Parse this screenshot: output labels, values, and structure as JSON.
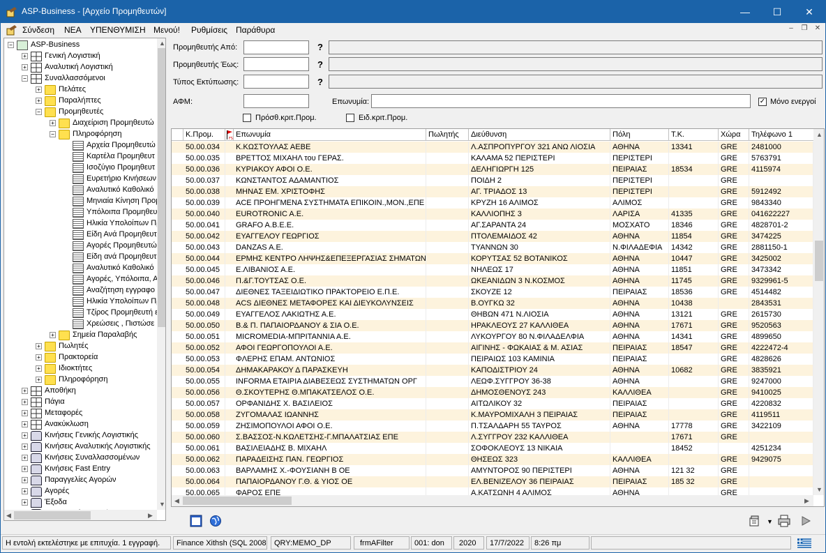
{
  "window": {
    "title": "ASP-Business - [Αρχείο Προμηθευτών]",
    "minimize": "—",
    "maximize": "☐",
    "close": "✕"
  },
  "menu": [
    "Σύνδεση",
    "ΝΕΑ",
    "ΥΠΕΝΘΥΜΙΣΗ",
    "Μενού!",
    "Ρυθμίσεις",
    "Παράθυρα"
  ],
  "mdi": {
    "minimize": "–",
    "restore": "❐",
    "close": "✕"
  },
  "tree": [
    {
      "label": "ASP-Business",
      "level": 0,
      "exp": "−",
      "icon": "root"
    },
    {
      "label": "Γενική Λογιστική",
      "level": 1,
      "exp": "+",
      "icon": "grid"
    },
    {
      "label": "Αναλυτική Λογιστική",
      "level": 1,
      "exp": "+",
      "icon": "grid"
    },
    {
      "label": "Συναλλασσόμενοι",
      "level": 1,
      "exp": "−",
      "icon": "grid"
    },
    {
      "label": "Πελάτες",
      "level": 2,
      "exp": "+",
      "icon": "folder"
    },
    {
      "label": "Παραλήπτες",
      "level": 2,
      "exp": "+",
      "icon": "folder"
    },
    {
      "label": "Προμηθευτές",
      "level": 2,
      "exp": "−",
      "icon": "folder"
    },
    {
      "label": "Διαχείριση Προμηθευτώ",
      "level": 3,
      "exp": "+",
      "icon": "folder"
    },
    {
      "label": "Πληροφόρηση",
      "level": 3,
      "exp": "−",
      "icon": "folder"
    },
    {
      "label": "Αρχεία Προμηθευτώ",
      "level": 4,
      "exp": "",
      "icon": "doc"
    },
    {
      "label": "Καρτέλα Προμηθευτ",
      "level": 4,
      "exp": "",
      "icon": "doc"
    },
    {
      "label": "Ισοζύγιο Προμηθευτ",
      "level": 4,
      "exp": "",
      "icon": "doc"
    },
    {
      "label": "Ευρετήριο Κινήσεων",
      "level": 4,
      "exp": "",
      "icon": "doc"
    },
    {
      "label": "Αναλυτικό Καθολικό",
      "level": 4,
      "exp": "",
      "icon": "doc"
    },
    {
      "label": "Μηνιαία Κίνηση Προμ",
      "level": 4,
      "exp": "",
      "icon": "doc"
    },
    {
      "label": "Υπόλοιπα Προμηθευτ",
      "level": 4,
      "exp": "",
      "icon": "doc"
    },
    {
      "label": "Ηλικία Υπολοίπων Πρ",
      "level": 4,
      "exp": "",
      "icon": "doc"
    },
    {
      "label": "Είδη Ανά Προμηθευτ",
      "level": 4,
      "exp": "",
      "icon": "doc"
    },
    {
      "label": "Αγορές Προμηθευτώ",
      "level": 4,
      "exp": "",
      "icon": "doc"
    },
    {
      "label": "Είδη ανά Προμηθευτ",
      "level": 4,
      "exp": "",
      "icon": "doc"
    },
    {
      "label": "Αναλυτικό Καθολικό",
      "level": 4,
      "exp": "",
      "icon": "doc"
    },
    {
      "label": "Αγορές, Υπόλοιπα, Α",
      "level": 4,
      "exp": "",
      "icon": "doc"
    },
    {
      "label": "Αναζήτηση εγγραφο",
      "level": 4,
      "exp": "",
      "icon": "doc"
    },
    {
      "label": "Ηλικία Υπολοίπων Πρ",
      "level": 4,
      "exp": "",
      "icon": "doc"
    },
    {
      "label": "Τζίρος Προμηθευτή ε",
      "level": 4,
      "exp": "",
      "icon": "doc"
    },
    {
      "label": "Χρεώσεις , Πιστώσε",
      "level": 4,
      "exp": "",
      "icon": "doc"
    },
    {
      "label": "Σημεία Παραλαβής",
      "level": 3,
      "exp": "+",
      "icon": "folder"
    },
    {
      "label": "Πωλητές",
      "level": 2,
      "exp": "+",
      "icon": "folder"
    },
    {
      "label": "Πρακτορεία",
      "level": 2,
      "exp": "+",
      "icon": "folder"
    },
    {
      "label": "Ιδιοκτήτες",
      "level": 2,
      "exp": "+",
      "icon": "folder"
    },
    {
      "label": "Πληροφόρηση",
      "level": 2,
      "exp": "+",
      "icon": "folder"
    },
    {
      "label": "Αποθήκη",
      "level": 1,
      "exp": "+",
      "icon": "grid"
    },
    {
      "label": "Πάγια",
      "level": 1,
      "exp": "+",
      "icon": "grid"
    },
    {
      "label": "Μεταφορές",
      "level": 1,
      "exp": "+",
      "icon": "grid"
    },
    {
      "label": "Ανακύκλωση",
      "level": 1,
      "exp": "+",
      "icon": "grid"
    },
    {
      "label": "Κινήσεις Γενικής Λογιστικής",
      "level": 1,
      "exp": "+",
      "icon": "print"
    },
    {
      "label": "Κινήσεις Αναλυτικής Λογιστικής",
      "level": 1,
      "exp": "+",
      "icon": "print"
    },
    {
      "label": "Κινήσεις Συναλλασσομένων",
      "level": 1,
      "exp": "+",
      "icon": "print"
    },
    {
      "label": "Κινήσεις Fast Entry",
      "level": 1,
      "exp": "+",
      "icon": "print"
    },
    {
      "label": "Παραγγελίες Αγορών",
      "level": 1,
      "exp": "+",
      "icon": "print"
    },
    {
      "label": "Αγορές",
      "level": 1,
      "exp": "+",
      "icon": "print"
    },
    {
      "label": "Έξοδα",
      "level": 1,
      "exp": "+",
      "icon": "print"
    },
    {
      "label": "Παραγγελίες Πωλήσεων",
      "level": 1,
      "exp": "+",
      "icon": "print"
    }
  ],
  "filters": {
    "from_label": "Προμηθευτής Από:",
    "to_label": "Προμηθευτής Έως:",
    "print_type_label": "Τύπος Εκτύπωσης:",
    "afm_label": "ΑΦΜ:",
    "name_label": "Επωνυμία:",
    "active_only_label": "Μόνο ενεργοί",
    "active_only_checked": "✓",
    "extra_crit_label": "Πρόσθ.κριτ.Προμ.",
    "special_crit_label": "Ειδ.κριτ.Προμ.",
    "from_value": "",
    "to_value": "",
    "print_type_value": "",
    "afm_value": "",
    "name_value": ""
  },
  "grid": {
    "columns": [
      "Κ.Προμ.",
      "Επωνυμία",
      "Πωλητής",
      "Διεύθυνση",
      "Πόλη",
      "Τ.Κ.",
      "Χώρα",
      "Τηλέφωνο 1"
    ],
    "flag_label": "FS",
    "rows": [
      [
        "50.00.034",
        "Κ.ΚΩΣΤΟΥΛΑΣ ΑΕΒΕ",
        "",
        "Λ.ΑΣΠΡΟΠΥΡΓΟΥ 321 ΑΝΩ ΛΙΟΣΙΑ",
        "ΑΘΗΝΑ",
        "13341",
        "GRE",
        "2481000"
      ],
      [
        "50.00.035",
        "ΒΡΕΤΤΟΣ ΜΙΧΑΗΛ του ΓΕΡΑΣ.",
        "",
        "ΚΑΛΑΜΑ 52 ΠΕΡΙΣΤΕΡΙ",
        "ΠΕΡΙΣΤΕΡΙ",
        "",
        "GRE",
        "5763791"
      ],
      [
        "50.00.036",
        "ΚΥΡΙΑΚΟΥ ΑΦΟΙ Ο.Ε.",
        "",
        "ΔΕΛΗΓΙΩΡΓΗ 125",
        "ΠΕΙΡΑΙΑΣ",
        "18534",
        "GRE",
        "4115974"
      ],
      [
        "50.00.037",
        "ΚΩΝΣΤΑΝΤΟΣ ΑΔΑΜΑΝΤΙΟΣ",
        "",
        "ΠΟΙΔΗ 2",
        "ΠΕΡΙΣΤΕΡΙ",
        "",
        "GRE",
        ""
      ],
      [
        "50.00.038",
        "ΜΗΝΑΣ ΕΜ. ΧΡΙΣΤΟΦΗΣ",
        "",
        "ΑΓ. ΤΡΙΑΔΟΣ 13",
        "ΠΕΡΙΣΤΕΡΙ",
        "",
        "GRE",
        "5912492"
      ],
      [
        "50.00.039",
        "ACE ΠΡΟΗΓΜΕΝΑ ΣΥΣΤΗΜΑΤΑ ΕΠΙΚΟΙΝ.,ΜΟΝ.,ΕΠΕ",
        "",
        "ΚΡΥΖΗ 16 ΑΛΙΜΟΣ",
        "ΑΛΙΜΟΣ",
        "",
        "GRE",
        "9843340"
      ],
      [
        "50.00.040",
        "EUROTRONIC A.E.",
        "",
        "ΚΑΛΛΙΟΠΗΣ 3",
        "ΛΑΡΙΣΑ",
        "41335",
        "GRE",
        "041622227"
      ],
      [
        "50.00.041",
        "GRAFO A.B.E.E.",
        "",
        "ΑΓ.ΣΑΡΑΝΤΑ 24",
        "ΜΟΣΧΑΤΟ",
        "18346",
        "GRE",
        "4828701-2"
      ],
      [
        "50.00.042",
        "ΕΥΑΓΓΕΛΟΥ ΓΕΩΡΓΙΟΣ",
        "",
        "ΠΤΟΛΕΜΑΙΔΟΣ 42",
        "ΑΘΗΝΑ",
        "11854",
        "GRE",
        "3474225"
      ],
      [
        "50.00.043",
        "DANZAS A.E.",
        "",
        "ΤΥΑΝΝΩΝ 30",
        "Ν.ΦΙΛΑΔΕΦΙΑ",
        "14342",
        "GRE",
        "2881150-1"
      ],
      [
        "50.00.044",
        "ΕΡΜΗΣ ΚΕΝΤΡΟ ΛΗΨΗΣ&ΕΠΕΞΕΡΓΑΣΙΑΣ ΣΗΜΑΤΩΝ",
        "",
        "ΚΟΡΥΤΣΑΣ 52 ΒΟΤΑΝΙΚΟΣ",
        "ΑΘΗΝΑ",
        "10447",
        "GRE",
        "3425002"
      ],
      [
        "50.00.045",
        "Ε.ΛΙΒΑΝΙΟΣ Α.Ε.",
        "",
        "ΝΗΛΕΩΣ 17",
        "ΑΘΗΝΑ",
        "11851",
        "GRE",
        "3473342"
      ],
      [
        "50.00.046",
        "Π.&Γ.ΤΟΥΤΣΑΣ Ο.Ε.",
        "",
        "ΩΚΕΑΝΙΔΩΝ 3 Ν.ΚΟΣΜΟΣ",
        "ΑΘΗΝΑ",
        "11745",
        "GRE",
        "9329961-5"
      ],
      [
        "50.00.047",
        "ΔΙΕΘΝΕΣ ΤΑΞΕΙΔΙΩΤΙΚΟ ΠΡΑΚΤΟΡΕΙΟ Ε.Π.Ε.",
        "",
        "ΣΚΟΥΖΕ 12",
        "ΠΕΙΡΑΙΑΣ",
        "18536",
        "GRE",
        "4514482"
      ],
      [
        "50.00.048",
        "ACS ΔΙΕΘΝΕΣ ΜΕΤΑΦΟΡΕΣ ΚΑΙ ΔΙΕΥΚΟΛΥΝΣΕΙΣ",
        "",
        "Β.ΟΥΓΚΩ 32",
        "ΑΘΗΝΑ",
        "10438",
        "",
        "2843531"
      ],
      [
        "50.00.049",
        "ΕΥΑΓΓΕΛΟΣ ΛΑΚΙΩΤΗΣ Α.Ε.",
        "",
        "ΘΗΒΩΝ 471 Ν.ΛΙΟΣΙΑ",
        "ΑΘΗΝΑ",
        "13121",
        "GRE",
        "2615730"
      ],
      [
        "50.00.050",
        "Β.& Π. ΠΑΠΑΙΟΡΔΑΝΟΥ & ΣΙΑ Ο.Ε.",
        "",
        "ΗΡΑΚΛΕΟΥΣ 27 ΚΑΛΛΙΘΕΑ",
        "ΑΘΗΝΑ",
        "17671",
        "GRE",
        "9520563"
      ],
      [
        "50.00.051",
        "MICROMEDIA-ΜΠΡΙΤΑΝΝΙΑ Α.Ε.",
        "",
        "ΛΥΚΟΥΡΓΟΥ 80 Ν.ΦΙΛΑΔΕΛΦΙΑ",
        "ΑΘΗΝΑ",
        "14341",
        "GRE",
        "4899650"
      ],
      [
        "50.00.052",
        "ΑΦΟΙ ΓΕΩΡΓΟΠΟΥΛΟΙ Α.Ε.",
        "",
        "ΑΙΓΙΝΗΣ - ΦΩΚΑΙΑΣ & Μ. ΑΣΙΑΣ",
        "ΠΕΙΡΑΙΑΣ",
        "18547",
        "GRE",
        "4222472-4"
      ],
      [
        "50.00.053",
        "ΦΛΕΡΗΣ ΕΠΑΜ. ΑΝΤΩΝΙΟΣ",
        "",
        "ΠΕΙΡΑΙΩΣ 103 ΚΑΜΙΝΙΑ",
        "ΠΕΙΡΑΙΑΣ",
        "",
        "GRE",
        "4828626"
      ],
      [
        "50.00.054",
        "ΔΗΜΑΚΑΡΑΚΟΥ Δ ΠΑΡΑΣΚΕΥΗ",
        "",
        "ΚΑΠΟΔΙΣΤΡΙΟΥ 24",
        "ΑΘΗΝΑ",
        "10682",
        "GRE",
        "3835921"
      ],
      [
        "50.00.055",
        "INFORMA ΕΤΑΙΡΙΑ ΔΙΑΒΕΣΕΩΣ ΣΥΣΤΗΜΑΤΩΝ ΟΡΓ",
        "",
        "ΛΕΩΦ.ΣΥΓΓΡΟΥ 36-38",
        "ΑΘΗΝΑ",
        "",
        "GRE",
        "9247000"
      ],
      [
        "50.00.056",
        "Θ.ΣΚΟΥΤΕΡΗΣ Θ.ΜΠΑΚΑΤΣΕΛΟΣ Ο.Ε.",
        "",
        "ΔΗΜΟΣΘΕΝΟΥΣ 243",
        "ΚΑΛΛΙΘΕΑ",
        "",
        "GRE",
        "9410025"
      ],
      [
        "50.00.057",
        "ΟΡΦΑΝΙΔΗΣ Χ. ΒΑΣΙΛΕΙΟΣ",
        "",
        "ΑΙΤΩΛΙΚΟΥ 32",
        "ΠΕΙΡΑΙΑΣ",
        "",
        "GRE",
        "4220832"
      ],
      [
        "50.00.058",
        "ΖΥΓΟΜΑΛΑΣ ΙΩΑΝΝΗΣ",
        "",
        "Κ.ΜΑΥΡΟΜΙΧΑΛΗ 3 ΠΕΙΡΑΙΑΣ",
        "ΠΕΙΡΑΙΑΣ",
        "",
        "GRE",
        "4119511"
      ],
      [
        "50.00.059",
        "ΖΗΣΙΜΟΠΟΥΛΟΙ ΑΦΟΙ Ο.Ε.",
        "",
        "Π.ΤΣΑΛΔΑΡΗ 55 ΤΑΥΡΟΣ",
        "ΑΘΗΝΑ",
        "17778",
        "GRE",
        "3422109"
      ],
      [
        "50.00.060",
        "Σ.ΒΑΣΣΟΣ-Ν.ΚΩΛΕΤΣΗΣ-Γ.ΜΠΑΛΑΤΣΙΑΣ ΕΠΕ",
        "",
        "Λ.ΣΥΓΓΡΟΥ 232 ΚΑΛΛΙΘΕΑ",
        "",
        "17671",
        "GRE",
        ""
      ],
      [
        "50.00.061",
        "ΒΑΣΙΛΕΙΑΔΗΣ Β. ΜΙΧΑΗΛ",
        "",
        "ΣΟΦΟΚΛΕΟΥΣ 13 ΝΙΚΑΙΑ",
        "",
        "18452",
        "",
        "4251234"
      ],
      [
        "50.00.062",
        "ΠΑΡΑΔΕΙΣΗΣ ΠΑΝ. ΓΕΩΡΓΙΟΣ",
        "",
        "ΘΗΣΕΩΣ 323",
        "ΚΑΛΛΙΘΕΑ",
        "",
        "GRE",
        "9429075"
      ],
      [
        "50.00.063",
        "ΒΑΡΛΑΜΗΣ Χ.-ΦΟΥΣΙΑΝΗ Β ΟΕ",
        "",
        "ΑΜΥΝΤΟΡΟΣ 90 ΠΕΡΙΣΤΕΡΙ",
        "ΑΘΗΝΑ",
        "121 32",
        "GRE",
        ""
      ],
      [
        "50.00.064",
        "ΠΑΠΑΙΟΡΔΑΝΟΥ Γ.Θ. & ΥΙΟΣ ΟΕ",
        "",
        "ΕΛ.ΒΕΝΙΖΕΛΟΥ 36 ΠΕΙΡΑΙΑΣ",
        "ΠΕΙΡΑΙΑΣ",
        "185 32",
        "GRE",
        ""
      ],
      [
        "50.00.065",
        "ΦΑΡΟΣ ΕΠΕ",
        "",
        "Α.ΚΑΤΣΩΝΗ 4 ΑΛΙΜΟΣ",
        "ΑΘΗΝΑ",
        "",
        "GRE",
        ""
      ]
    ]
  },
  "status": [
    "Η εντολή εκτελέστηκε με επιτυχία. 1 εγγραφή.",
    "Finance Xithsh (SQL 2008)",
    "QRY:MEMO_DP",
    "frmAFilter",
    "001: don",
    "2020",
    "17/7/2022",
    "8:26 πμ",
    ""
  ],
  "colors": {
    "titlebar": "#1b63a9",
    "row_alt": "#fdf3dd"
  }
}
